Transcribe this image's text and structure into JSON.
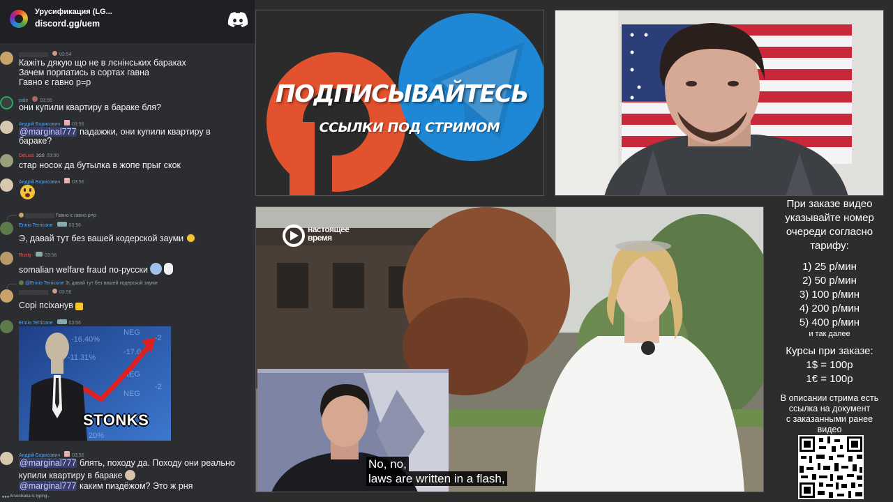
{
  "server": {
    "name": "Урусификация (LG...",
    "invite": "discord.gg/uem"
  },
  "chat": {
    "messages": [
      {
        "time": "03:54",
        "lines": [
          "Кажіть дякую що не в лєнінських бараках",
          "Зачем порпатись в сортах гавна",
          "Гавно є гавно р=р"
        ]
      },
      {
        "name": "pale",
        "time": "03:55",
        "lines": [
          "они купили квартиру в бараке бля?"
        ]
      },
      {
        "name": "Андрій Борисович",
        "time": "03:56",
        "mention": "@marginal777",
        "lines": [
          " падажжи, они купили квартиру в",
          "бараке?"
        ]
      },
      {
        "name": "DeLuis",
        "badge": "2GS",
        "time": "03:56",
        "lines": [
          "стар носок да бутылка в жопе прыг скок"
        ]
      },
      {
        "name": "Андрій Борисович",
        "time": "03:56"
      },
      {
        "reply": "Гавно є гавно р=р",
        "name": "Ennio Terricone",
        "time": "03:56",
        "lines": [
          "Э, давай тут без вашей кодерской зауми"
        ]
      },
      {
        "name": "Rusty",
        "time": "03:56",
        "lines": [
          "somalian welfare fraud по-русски"
        ]
      },
      {
        "reply_name": "@Ennio Terricone",
        "reply": "Э, давай тут без вашей кодерской зауми",
        "time": "03:56",
        "lines": [
          "Сорі псіханув"
        ]
      },
      {
        "name": "Ennio Terricone",
        "time": "03:56",
        "image_text": "STONKS"
      },
      {
        "name": "Андрій Борисович",
        "time": "03:56",
        "mention": "@marginal777",
        "lines": [
          " блять, походу да. Походу они реально",
          "купили квартиру в бараке"
        ],
        "mention2": "@marginal777",
        "line3": " каким пиздёжом? Это ж рня"
      }
    ],
    "typing": "Arsenikaka is typing..."
  },
  "promo": {
    "title": "ПОДПИСЫВАЙТЕСЬ",
    "subtitle": "ССЫЛКИ ПОД СТРИМОМ",
    "colors": {
      "patreon": "#e2522e",
      "telegram": "#1e88d6"
    }
  },
  "video": {
    "logo_line1": "настоящее",
    "logo_line2": "время",
    "subtitle_line1": "No, no,",
    "subtitle_line2": "laws are written in a flash,"
  },
  "info": {
    "heading": [
      "При заказе видео",
      "указывайте номер",
      "очереди согласно",
      "тарифу:"
    ],
    "tariffs": [
      "1) 25 р/мин",
      "2) 50 р/мин",
      "3) 100 р/мин",
      "4) 200 р/мин",
      "5) 400 р/мин"
    ],
    "etc": "и так далее",
    "rates_title": "Курсы при заказе:",
    "rates": [
      "1$ = 100р",
      "1€ = 100р"
    ],
    "desc": [
      "В описании стрима есть",
      "ссылка на документ",
      "с заказанными ранее",
      "видео"
    ]
  }
}
